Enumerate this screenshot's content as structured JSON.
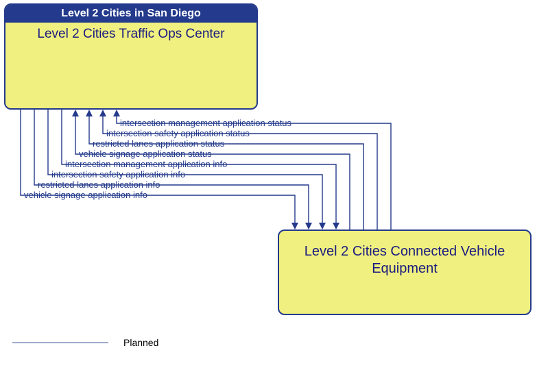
{
  "nodes": {
    "top": {
      "header": "Level 2 Cities in San Diego",
      "title": "Level 2 Cities Traffic Ops Center"
    },
    "bottom": {
      "title": "Level 2 Cities Connected Vehicle Equipment"
    }
  },
  "flows": {
    "to_bottom": [
      "vehicle signage application info",
      "restricted lanes application info",
      "intersection safety application info",
      "intersection management application info"
    ],
    "to_top": [
      "vehicle signage application status",
      "restricted lanes application status",
      "intersection safety application status",
      "intersection management application status"
    ]
  },
  "legend": {
    "planned": "Planned"
  },
  "colors": {
    "line": "#243a8c",
    "node_fill": "#f0f080",
    "header_fill": "#243a8c"
  }
}
